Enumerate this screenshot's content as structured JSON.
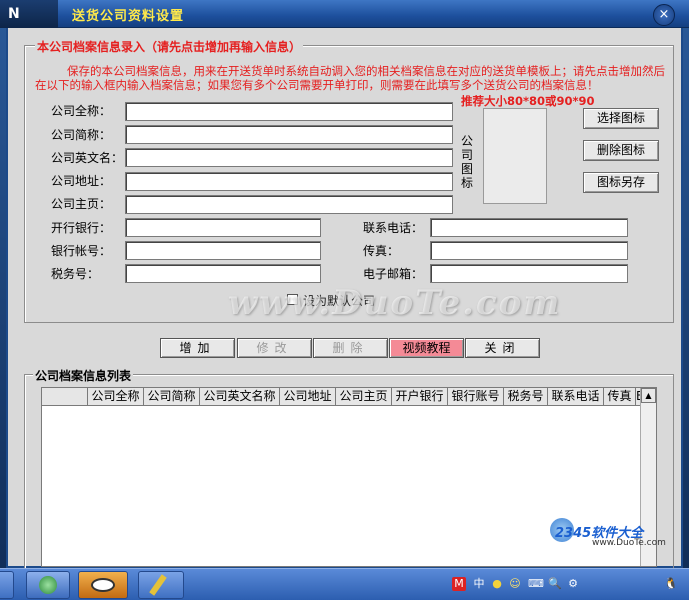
{
  "window": {
    "title": "送货公司资料设置",
    "logo_text": "N"
  },
  "entry_group": {
    "title": "本公司档案信息录入（请先点击增加再输入信息）",
    "notice": "保存的本公司档案信息，用来在开送货单时系统自动调入您的相关档案信息在对应的送货单模板上；请先点击增加然后在以下的输入框内输入档案信息；如果您有多个公司需要开单打印，则需要在此填写多个送货公司的档案信息！",
    "recommend_size": "推荐大小80*80或90*90",
    "fields_left": [
      {
        "label": "公司全称：",
        "value": ""
      },
      {
        "label": "公司简称：",
        "value": ""
      },
      {
        "label": "公司英文名：",
        "value": ""
      },
      {
        "label": "公司地址：",
        "value": ""
      },
      {
        "label": "公司主页：",
        "value": ""
      }
    ],
    "fields_bottom_left": [
      {
        "label": "开行银行：",
        "value": ""
      },
      {
        "label": "银行帐号：",
        "value": ""
      },
      {
        "label": "税务号：",
        "value": ""
      }
    ],
    "fields_bottom_right": [
      {
        "label": "联系电话：",
        "value": ""
      },
      {
        "label": "传真：",
        "value": ""
      },
      {
        "label": "电子邮箱：",
        "value": ""
      }
    ],
    "logo_label": "公司图标",
    "logo_buttons": {
      "select": "选择图标",
      "delete": "删除图标",
      "save_as": "图标另存"
    },
    "checkbox_label": "设为默认公司",
    "watermark": "www.DuoTe.com"
  },
  "actions": {
    "add": "增加",
    "modify": "修改",
    "delete": "删除",
    "video": "视频教程",
    "close": "关闭"
  },
  "list_group": {
    "title": "公司档案信息列表",
    "columns": [
      "",
      "公司全称",
      "公司简称",
      "公司英文名称",
      "公司地址",
      "公司主页",
      "开户银行",
      "银行账号",
      "税务号",
      "联系电话",
      "传真",
      "E"
    ]
  },
  "brand": {
    "name": "2345软件大全",
    "url": "www.DuoTe.com"
  },
  "taskbar": {
    "tray": [
      "M",
      "中",
      "●",
      "☺",
      "⌨",
      "🔍",
      "⚙",
      "🐧"
    ]
  }
}
